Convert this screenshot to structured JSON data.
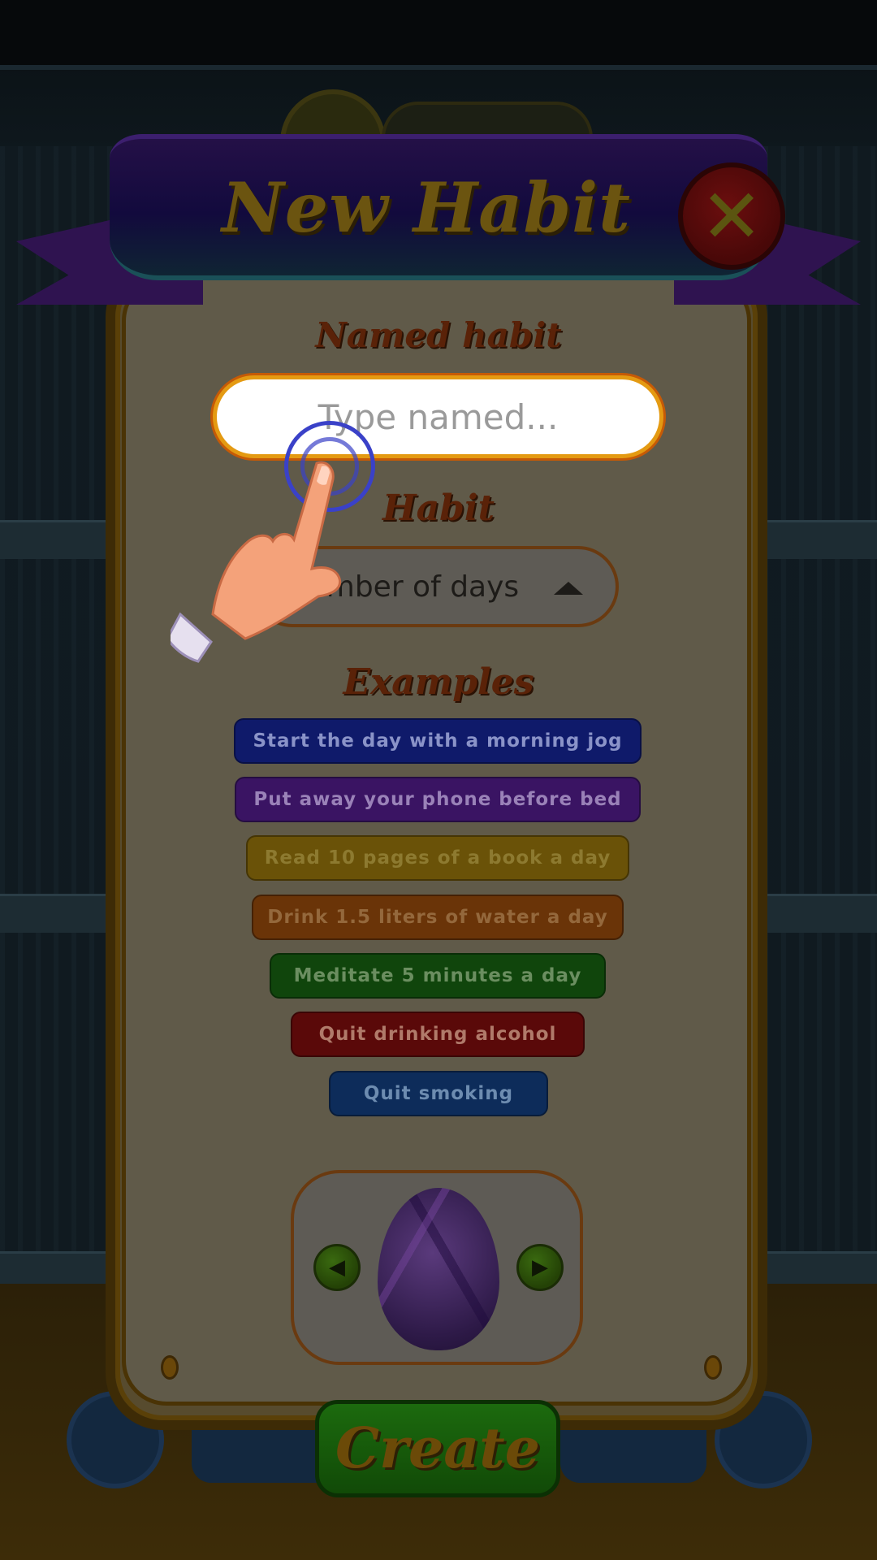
{
  "modal": {
    "title": "New Habit",
    "close_symbol": "✕"
  },
  "named_habit": {
    "label": "Named habit",
    "placeholder": "Type named..."
  },
  "habit": {
    "label": "Habit",
    "selected_value": "Number of days"
  },
  "examples": {
    "label": "Examples",
    "items": [
      {
        "text": "Start the day with a morning jog",
        "color": "#0f1a6a"
      },
      {
        "text": "Put away your phone before bed",
        "color": "#3a1463"
      },
      {
        "text": "Read 10 pages of a book a day",
        "color": "#6a5208"
      },
      {
        "text": "Drink 1.5 liters of water a day",
        "color": "#6a3408"
      },
      {
        "text": "Meditate 5 minutes a day",
        "color": "#10450c"
      },
      {
        "text": "Quit drinking alcohol",
        "color": "#5a0909"
      },
      {
        "text": "Quit smoking",
        "color": "#0d2c5a"
      }
    ]
  },
  "egg_selector": {
    "prev_icon": "◀",
    "next_icon": "▶"
  },
  "create_button": {
    "label": "Create"
  },
  "colors": {
    "panel": "#605a49",
    "accent_orange": "#e49a12",
    "ripple": "#3a41c8"
  }
}
